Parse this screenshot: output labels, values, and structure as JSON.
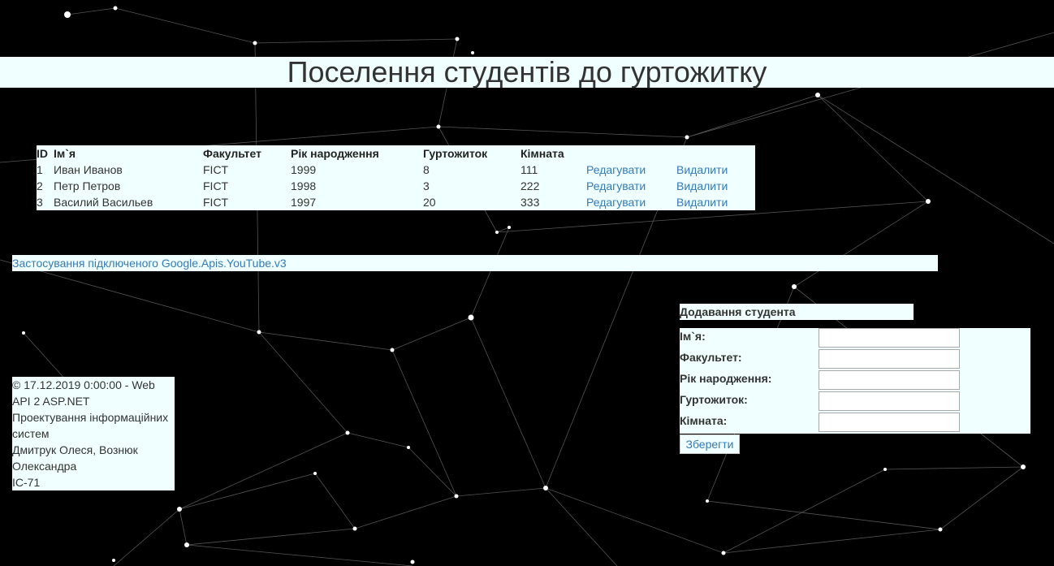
{
  "header": {
    "title": "Поселення студентів до гуртожитку"
  },
  "students_table": {
    "columns": [
      "ID",
      "Ім`я",
      "Факультет",
      "Рік народження",
      "Гуртожиток",
      "Кімната"
    ],
    "rows": [
      {
        "id": "1",
        "name": "Иван Иванов",
        "faculty": "FICT",
        "year": "1999",
        "dorm": "8",
        "room": "111",
        "edit": "Редагувати",
        "delete": "Видалити"
      },
      {
        "id": "2",
        "name": "Петр Петров",
        "faculty": "FICT",
        "year": "1998",
        "dorm": "3",
        "room": "222",
        "edit": "Редагувати",
        "delete": "Видалити"
      },
      {
        "id": "3",
        "name": "Василий Васильев",
        "faculty": "FICT",
        "year": "1997",
        "dorm": "20",
        "room": "333",
        "edit": "Редагувати",
        "delete": "Видалити"
      }
    ]
  },
  "youtube_link": "Застосування підключеного Google.Apis.YouTube.v3",
  "footer": {
    "lines": [
      "© 17.12.2019 0:00:00 - Web API 2 ASP.NET",
      "Проектування інформаційних систем",
      "Дмитрук Олеся, Вознюк Олександра",
      "ІС-71"
    ]
  },
  "add_form": {
    "title": "Додавання студента",
    "fields": [
      {
        "label": "Ім`я:",
        "value": ""
      },
      {
        "label": "Факультет:",
        "value": ""
      },
      {
        "label": "Рік народження:",
        "value": ""
      },
      {
        "label": "Гуртожиток:",
        "value": ""
      },
      {
        "label": "Кімната:",
        "value": ""
      }
    ],
    "save_label": "Зберегти"
  },
  "colors": {
    "panel_bg": "#f0ffff",
    "link": "#337ab7",
    "page_bg": "#000000"
  }
}
